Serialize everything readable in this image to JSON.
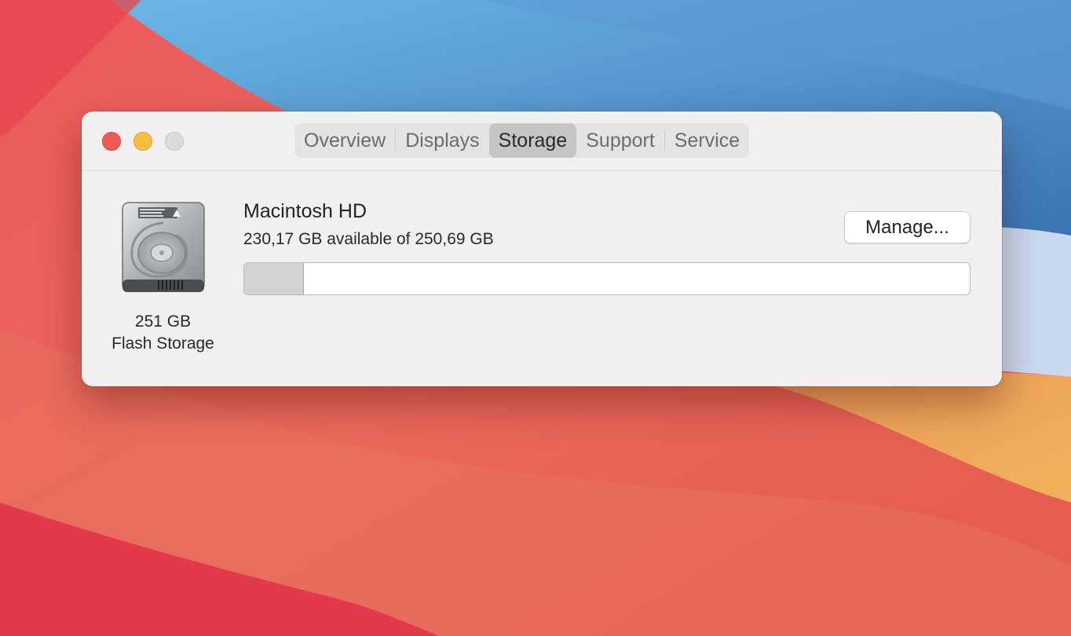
{
  "window": {
    "tabs": [
      {
        "label": "Overview"
      },
      {
        "label": "Displays"
      },
      {
        "label": "Storage",
        "active": true
      },
      {
        "label": "Support"
      },
      {
        "label": "Service"
      }
    ]
  },
  "disk": {
    "icon": "hard-disk-icon",
    "capacity": "251 GB",
    "type": "Flash Storage"
  },
  "volume": {
    "name": "Macintosh HD",
    "availability": "230,17 GB available of 250,69 GB",
    "used_fraction": 0.082,
    "manage_label": "Manage..."
  },
  "colors": {
    "close": "#ee5d56",
    "minimize": "#f5be3f",
    "zoom": "#dcdadb",
    "active_tab": "#c7c4c5",
    "used_storage": "#d3d1d1"
  }
}
